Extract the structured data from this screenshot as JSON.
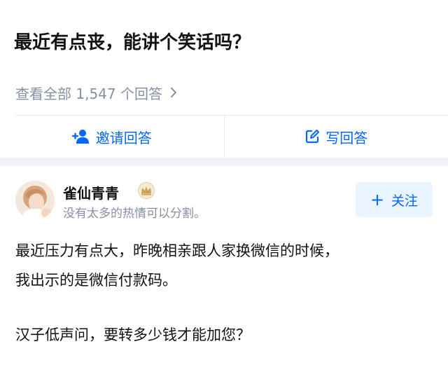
{
  "question": {
    "title": "最近有点丧，能讲个笑话吗？",
    "view_all_label": "查看全部 1,547 个回答"
  },
  "actions": {
    "invite_label": "邀请回答",
    "write_label": "写回答"
  },
  "author": {
    "name": "雀仙青青",
    "bio": "没有太多的热情可以分割。",
    "badge_icon": "crown-icon"
  },
  "follow": {
    "label": "关注"
  },
  "answer": {
    "line1": "最近压力有点大，昨晚相亲跟人家换微信的时候，",
    "line2": "我出示的是微信付款码。",
    "line3": "汉子低声问，要转多少钱才能加您？"
  },
  "colors": {
    "accent": "#0066ff",
    "muted_text": "#8590a6",
    "follow_bg": "#ebf5ff",
    "separator_band": "#f0f2f7"
  }
}
